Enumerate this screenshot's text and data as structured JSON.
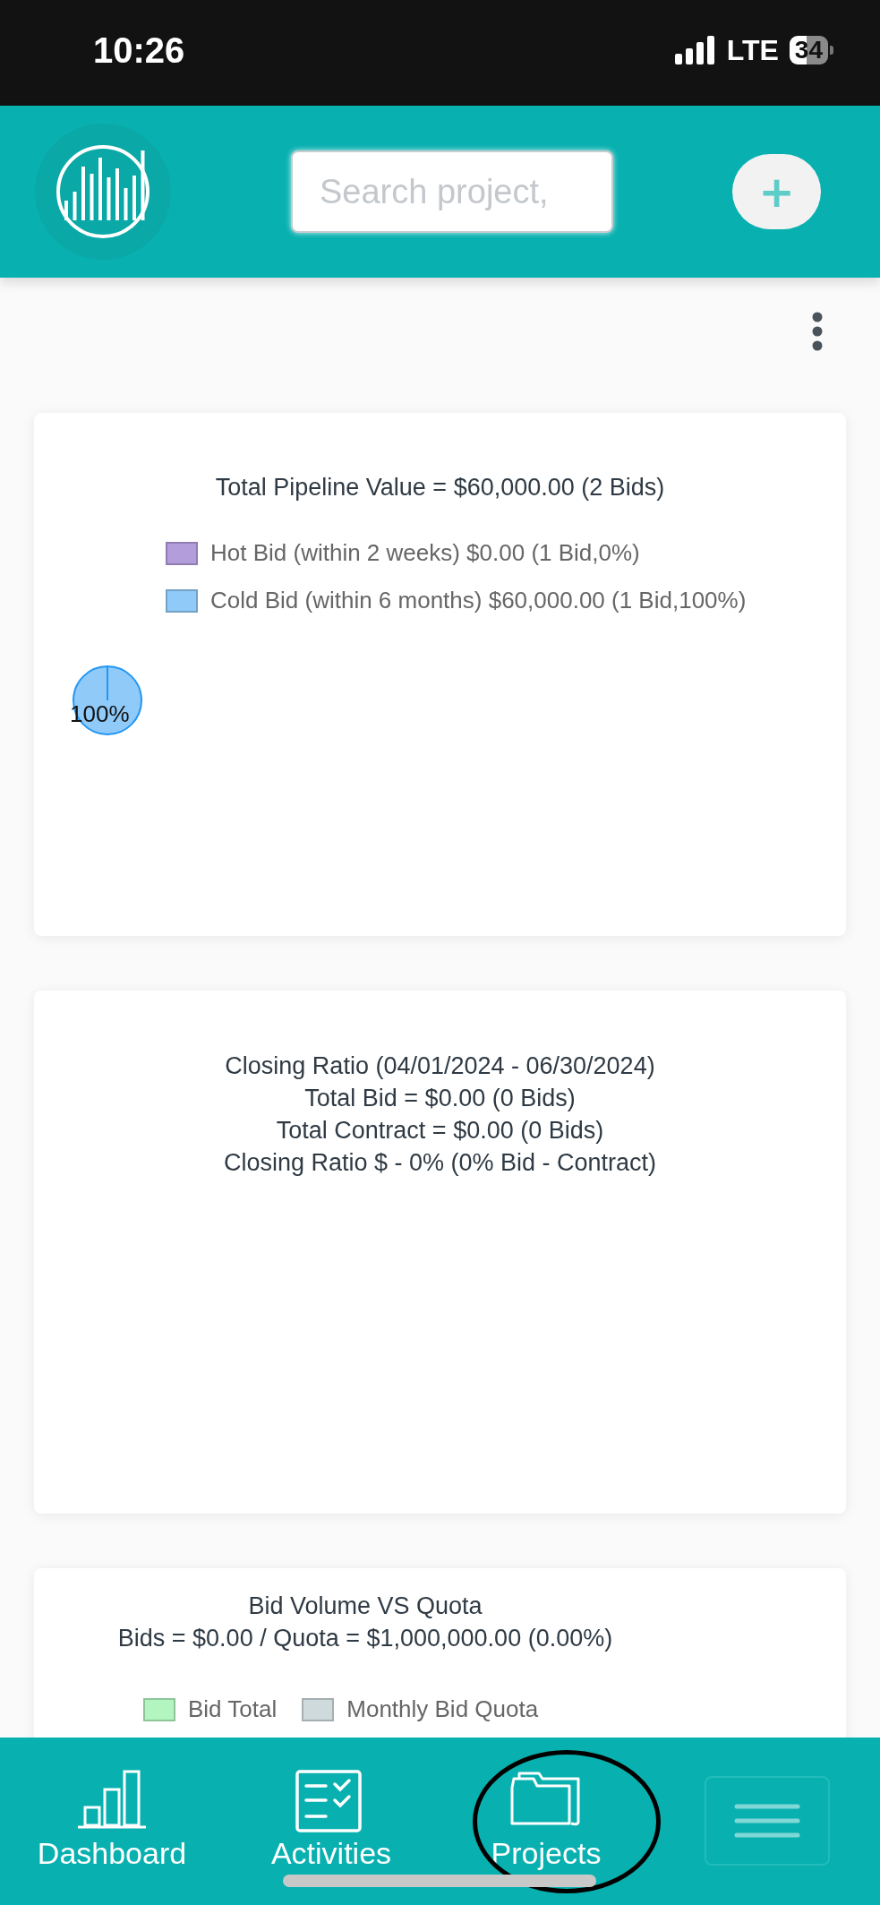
{
  "status_bar": {
    "time": "10:26",
    "network": "LTE",
    "battery": "34"
  },
  "header": {
    "search": {
      "placeholder": "Search project,"
    },
    "add_button": {
      "label": "+"
    }
  },
  "pipeline_card": {
    "title": "Total Pipeline Value = $60,000.00 (2 Bids)",
    "legend": [
      {
        "label": "Hot Bid (within 2 weeks) $0.00 (1 Bid,0%)",
        "color": "#b39ddb"
      },
      {
        "label": "Cold Bid (within 6 months) $60,000.00 (1 Bid,100%)",
        "color": "#90caf9"
      }
    ],
    "chart_data": {
      "type": "pie",
      "values": [
        0,
        100
      ],
      "value_labels": [
        null,
        "100%"
      ]
    }
  },
  "closing_card": {
    "lines": [
      "Closing Ratio (04/01/2024 - 06/30/2024)",
      "Total Bid = $0.00 (0 Bids)",
      "Total Contract = $0.00 (0 Bids)",
      "Closing Ratio $ - 0% (0% Bid - Contract)"
    ]
  },
  "quota_card": {
    "title": "Bid Volume VS Quota",
    "subtitle": "Bids = $0.00 / Quota = $1,000,000.00 (0.00%)",
    "legend": [
      {
        "label": "Bid Total",
        "color": "#b3f5c0"
      },
      {
        "label": "Monthly Bid Quota",
        "color": "#cfdadd"
      }
    ]
  },
  "bottom_nav": [
    {
      "label": "Dashboard",
      "kind": "chart"
    },
    {
      "label": "Activities",
      "kind": "checklist"
    },
    {
      "label": "Projects",
      "kind": "folder"
    },
    {
      "kind": "menu"
    }
  ]
}
